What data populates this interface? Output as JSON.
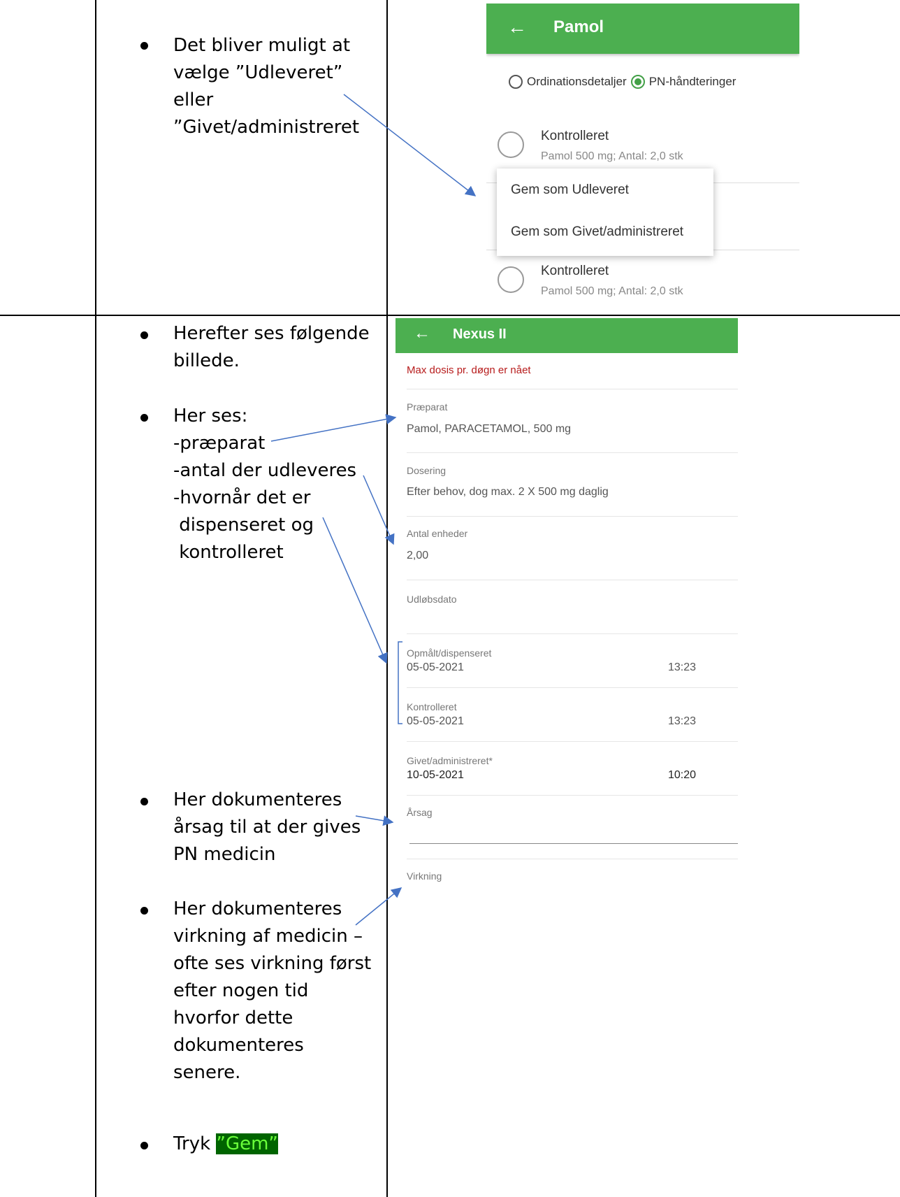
{
  "row1": {
    "bullet_lines": [
      "Det bliver muligt at",
      "vælge ”Udleveret”",
      "eller",
      "”Givet/administreret"
    ],
    "screen": {
      "title": "Pamol",
      "back_icon": "←",
      "radio_options": [
        "Ordinationsdetaljer",
        "PN-håndteringer"
      ],
      "items": [
        {
          "title": "Kontrolleret",
          "subtitle": "Pamol 500 mg; Antal: 2,0 stk"
        },
        {
          "title": "Kontrolleret",
          "subtitle": "Pamol 500 mg; Antal: 2,0 stk"
        }
      ],
      "menu": [
        "Gem som Udleveret",
        "Gem som Givet/administreret"
      ]
    }
  },
  "row2": {
    "bullets": {
      "b1": [
        "Herefter ses følgende",
        "billede."
      ],
      "b2": [
        "Her ses:",
        "-præparat",
        "-antal der udleveres",
        "-hvornår det er",
        " dispenseret og",
        " kontrolleret"
      ],
      "b3": [
        "Her dokumenteres",
        "årsag til at der gives",
        "PN medicin"
      ],
      "b4": [
        "Her dokumenteres",
        "virkning af medicin –",
        "ofte ses virkning først",
        "efter nogen tid",
        "hvorfor dette",
        "dokumenteres",
        "senere."
      ],
      "b5_prefix": "Tryk ",
      "b5_highlight": "”Gem”"
    },
    "screen": {
      "title": "Nexus II",
      "back_icon": "←",
      "warning": "Max dosis pr. døgn er nået",
      "praeparat_label": "Præparat",
      "praeparat_value": "Pamol, PARACETAMOL, 500 mg",
      "dosering_label": "Dosering",
      "dosering_value": "Efter behov, dog max. 2 X 500 mg daglig",
      "antal_label": "Antal enheder",
      "antal_value": "2,00",
      "udlob_label": "Udløbsdato",
      "opmaalt_label": "Opmålt/dispenseret",
      "opmaalt_date": "05-05-2021",
      "opmaalt_time": "13:23",
      "kontrol_label": "Kontrolleret",
      "kontrol_date": "05-05-2021",
      "kontrol_time": "13:23",
      "givet_label": "Givet/administreret*",
      "givet_date": "10-05-2021",
      "givet_time": "10:20",
      "aarsag_label": "Årsag",
      "virkning_label": "Virkning"
    }
  },
  "colors": {
    "appbar": "#4caf50",
    "arrow": "#4472c4",
    "highlight_bg": "#006400",
    "highlight_fg": "#6aff3a",
    "warning": "#b71c1c"
  }
}
